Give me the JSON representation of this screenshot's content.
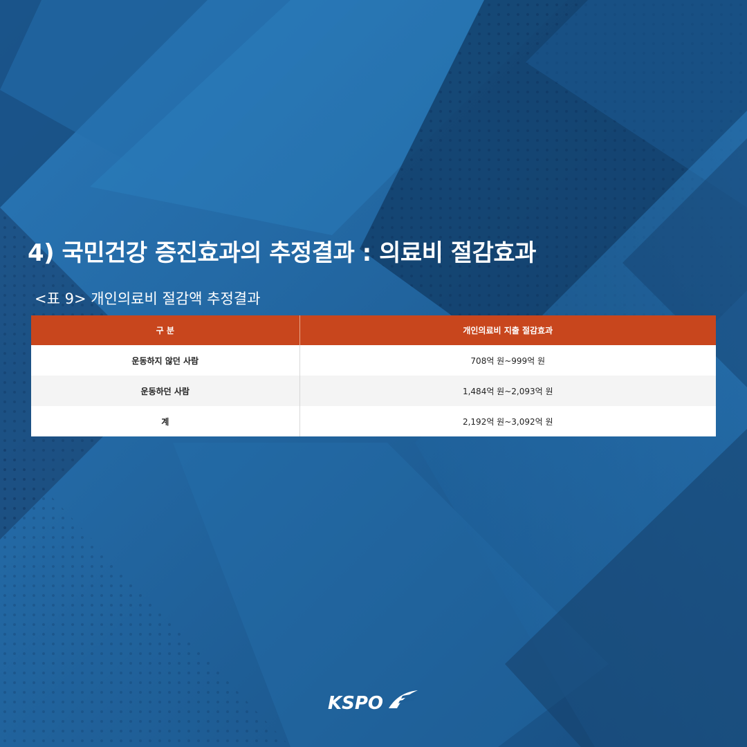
{
  "heading": {
    "title": "4) 국민건강 증진효과의 추정결과 : 의료비 절감효과",
    "table_caption": "<표 9> 개인의료비 절감액 추정결과"
  },
  "table": {
    "headers": [
      "구 분",
      "개인의료비 지출 절감효과"
    ],
    "rows": [
      {
        "label": "운동하지 않던 사람",
        "value": "708억 원~999억 원"
      },
      {
        "label": "운동하던 사람",
        "value": "1,484억 원~2,093억 원"
      },
      {
        "label": "계",
        "value": "2,192억 원~3,092억 원"
      }
    ]
  },
  "logo": {
    "text": "KSPO",
    "icon": "kspo-swoosh-icon"
  },
  "colors": {
    "background": "#1e5f98",
    "header_accent": "#c8461d",
    "text_light": "#ffffff"
  }
}
